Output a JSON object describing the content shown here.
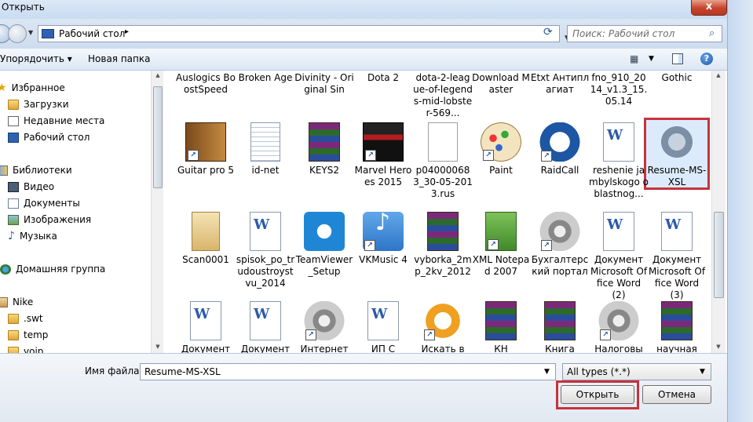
{
  "window": {
    "title": "Открыть",
    "close_symbol": "x"
  },
  "nav": {
    "address": "Рабочий стол",
    "address_arrow": "▸",
    "search_placeholder": "Поиск: Рабочий стол"
  },
  "toolbar": {
    "organize": "Упорядочить ▾",
    "new_folder": "Новая папка",
    "help": "?"
  },
  "sidebar": {
    "items": [
      {
        "label": "Избранное",
        "icon": "star-icon"
      },
      {
        "label": "Загрузки",
        "icon": "folder-icon"
      },
      {
        "label": "Недавние места",
        "icon": "recent-places-icon"
      },
      {
        "label": "Рабочий стол",
        "icon": "desktop-icon"
      },
      {
        "label": "Библиотеки",
        "icon": "library-icon"
      },
      {
        "label": "Видео",
        "icon": "video-icon"
      },
      {
        "label": "Документы",
        "icon": "documents-icon"
      },
      {
        "label": "Изображения",
        "icon": "images-icon"
      },
      {
        "label": "Музыка",
        "icon": "music-icon"
      },
      {
        "label": "Домашняя группа",
        "icon": "homegroup-icon"
      },
      {
        "label": "Nike",
        "icon": "user-folder-icon"
      },
      {
        "label": ".swt",
        "icon": "folder-icon"
      },
      {
        "label": "temp",
        "icon": "folder-icon"
      },
      {
        "label": "voip",
        "icon": "folder-icon"
      }
    ]
  },
  "files": {
    "row0": [
      "Auslogics BoostSpeed",
      "Broken Age",
      "Divinity - Original Sin",
      "Dota 2",
      "dota-2-league-of-legends-mid-lobster-569...",
      "Download Master",
      "Etxt Антиплагиат",
      "fno_910_2014_v1.3_15.05.14",
      "Gothic"
    ],
    "row1": [
      "Guitar pro 5",
      "id-net",
      "KEYS2",
      "Marvel Heroes 2015",
      "p040000683_30-05-2013.rus",
      "Paint",
      "RaidCall",
      "reshenie jambylskogo oblastnog...",
      "Resume-MS-XSL"
    ],
    "row2": [
      "Scan0001",
      "spisok_po_trudoustroystvu_2014",
      "TeamViewer_Setup",
      "VKMusic 4",
      "vyborka_2mp_2kv_2012",
      "XML Notepad 2007",
      "Бухгалтерский портал",
      "Документ Microsoft Office Word (2)",
      "Документ Microsoft Office Word (3)"
    ],
    "row3": [
      "Документ",
      "Документ",
      "Интернет",
      "ИП С",
      "Искать в",
      "КН",
      "Книга",
      "Налоговы",
      "научная"
    ]
  },
  "bottom": {
    "filename_label": "Имя файла:",
    "filename_value": "Resume-MS-XSL",
    "filetype": "All types (*.*)",
    "open_button": "Открыть",
    "cancel_button": "Отмена"
  },
  "colors": {
    "highlight": "#c6333c",
    "selection_bg": "#dcebfc"
  }
}
